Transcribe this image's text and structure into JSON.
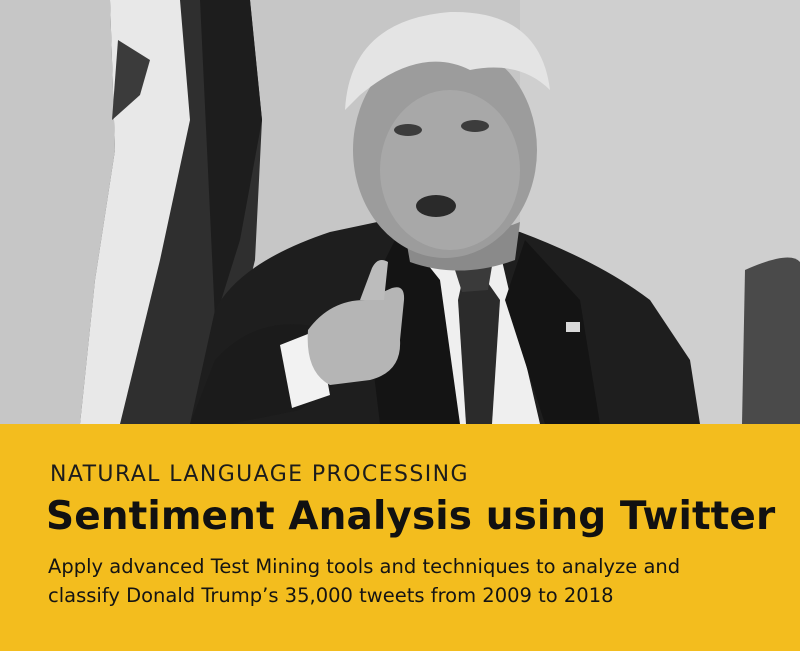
{
  "banner": {
    "eyebrow": "NATURAL LANGUAGE PROCESSING",
    "title": "Sentiment Analysis using Twitter",
    "description_line_1": "Apply advanced Test Mining tools and techniques to analyze and",
    "description_line_2": "classify Donald Trump’s 35,000 tweets from 2009 to 2018"
  },
  "colors": {
    "banner_background": "#f3bd1e",
    "text": "#111111"
  }
}
